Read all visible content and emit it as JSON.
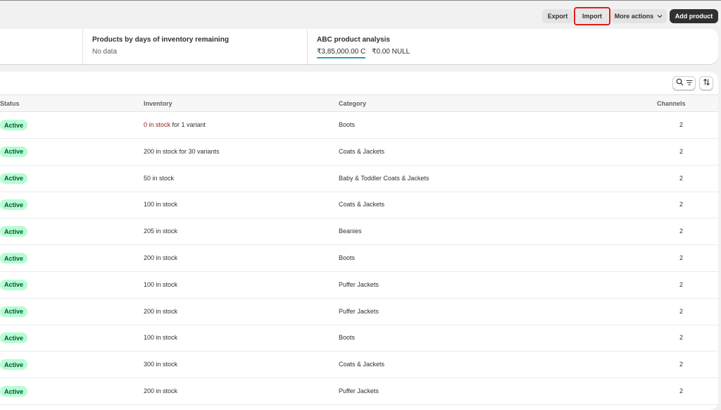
{
  "toolbar": {
    "export_label": "Export",
    "import_label": "Import",
    "more_actions_label": "More actions",
    "add_product_label": "Add product",
    "colors": {
      "highlight": "#e11b1b",
      "primary_button": "#303030"
    }
  },
  "metrics": {
    "days_inventory": {
      "title": "Products by days of inventory remaining",
      "value": "No data"
    },
    "abc": {
      "title": "ABC product analysis",
      "value_c": "₹3,85,000.00 C",
      "value_null": "₹0.00 NULL"
    }
  },
  "table": {
    "columns": {
      "status": "Status",
      "inventory": "Inventory",
      "category": "Category",
      "channels": "Channels"
    },
    "rows": [
      {
        "status": "Active",
        "inventory_prefix": "0 in stock",
        "inventory_suffix": " for 1 variant",
        "category": "Boots",
        "channels": "2",
        "out_of_stock": true
      },
      {
        "status": "Active",
        "inventory_prefix": "",
        "inventory_suffix": "200 in stock for 30 variants",
        "category": "Coats & Jackets",
        "channels": "2",
        "out_of_stock": false
      },
      {
        "status": "Active",
        "inventory_prefix": "",
        "inventory_suffix": "50 in stock",
        "category": "Baby & Toddler Coats & Jackets",
        "channels": "2",
        "out_of_stock": false
      },
      {
        "status": "Active",
        "inventory_prefix": "",
        "inventory_suffix": "100 in stock",
        "category": "Coats & Jackets",
        "channels": "2",
        "out_of_stock": false
      },
      {
        "status": "Active",
        "inventory_prefix": "",
        "inventory_suffix": "205 in stock",
        "category": "Beanies",
        "channels": "2",
        "out_of_stock": false
      },
      {
        "status": "Active",
        "inventory_prefix": "",
        "inventory_suffix": "200 in stock",
        "category": "Boots",
        "channels": "2",
        "out_of_stock": false
      },
      {
        "status": "Active",
        "inventory_prefix": "",
        "inventory_suffix": "100 in stock",
        "category": "Puffer Jackets",
        "channels": "2",
        "out_of_stock": false
      },
      {
        "status": "Active",
        "inventory_prefix": "",
        "inventory_suffix": "200 in stock",
        "category": "Puffer Jackets",
        "channels": "2",
        "out_of_stock": false
      },
      {
        "status": "Active",
        "inventory_prefix": "",
        "inventory_suffix": "100 in stock",
        "category": "Boots",
        "channels": "2",
        "out_of_stock": false
      },
      {
        "status": "Active",
        "inventory_prefix": "",
        "inventory_suffix": "300 in stock",
        "category": "Coats & Jackets",
        "channels": "2",
        "out_of_stock": false
      },
      {
        "status": "Active",
        "inventory_prefix": "",
        "inventory_suffix": "200 in stock",
        "category": "Puffer Jackets",
        "channels": "2",
        "out_of_stock": false
      }
    ]
  },
  "icons": {
    "search": "search-icon",
    "filter": "filter-icon",
    "sort": "sort-icon",
    "chevron": "chevron-down-icon"
  }
}
